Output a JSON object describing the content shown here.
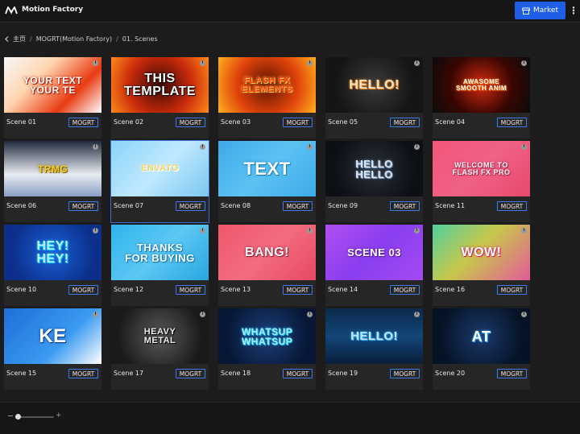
{
  "app": {
    "title": "Motion Factory"
  },
  "header": {
    "market_label": "Market"
  },
  "breadcrumb": [
    "主页",
    "MOGRT(Motion Factory)",
    "01. Scenes"
  ],
  "zoom": {
    "value": 0.08
  },
  "tiles": [
    {
      "label": "Scene 01",
      "badge": "MOGRT",
      "thumb": "YOUR TEXT\nYOUR TE",
      "bg": "linear-gradient(135deg,#f7f7f7 0%,#ffd6b0 35%,#e83b12 70%,#ffffff 100%)",
      "fg": "#ffffff",
      "shadow": "#b01a00",
      "size": 12
    },
    {
      "label": "Scene 02",
      "badge": "MOGRT",
      "thumb": "THIS\nTEMPLATE",
      "bg": "radial-gradient(circle at 50% 50%,#3a0a05 0%,#c92a0a 55%,#ff8a1a 100%)",
      "fg": "#ffffff",
      "shadow": "#000000",
      "size": 16
    },
    {
      "label": "Scene 03",
      "badge": "MOGRT",
      "thumb": "FLASH FX\nELEMENTS",
      "bg": "radial-gradient(circle at 50% 50%,#5a1200 0%,#e0430b 55%,#ffb01f 100%)",
      "fg": "#ff3a1a",
      "shadow": "#ffd24d",
      "size": 11
    },
    {
      "label": "Scene 05",
      "badge": "MOGRT",
      "thumb": "HELLO!",
      "bg": "radial-gradient(circle at 50% 50%,#3b3b3b 0%,#151515 70%)",
      "fg": "#f6e7c8",
      "shadow": "#ff8a1a",
      "size": 16
    },
    {
      "label": "Scene 04",
      "badge": "MOGRT",
      "thumb": "AWASOME\nSMOOTH ANIM",
      "bg": "radial-gradient(circle at 50% 50%,#d12a0f 0%,#3a0602 55%,#0b0b0b 100%)",
      "fg": "#ffffff",
      "shadow": "#ff6a00",
      "size": 8
    },
    {
      "label": "Scene 06",
      "badge": "MOGRT",
      "thumb": "TRMG",
      "bg": "linear-gradient(180deg,#20293c 0%,#e8ecf2 60%,#8aa0c4 100%)",
      "fg": "#f3d12a",
      "shadow": "#7a5a00",
      "size": 12
    },
    {
      "label": "Scene 07",
      "badge": "MOGRT",
      "thumb": "ENVATO",
      "bg": "linear-gradient(135deg,#8ad4f7 0%,#bfe8ff 50%,#7cc8ef 100%)",
      "fg": "#f4d35e",
      "shadow": "#ffffff",
      "size": 11
    },
    {
      "label": "Scene 08",
      "badge": "MOGRT",
      "thumb": "TEXT",
      "bg": "linear-gradient(135deg,#3ea9e8 0%,#5cc3f2 50%,#3ea9e8 100%)",
      "fg": "#ffffff",
      "shadow": "#1a7fc0",
      "size": 22
    },
    {
      "label": "Scene 09",
      "badge": "MOGRT",
      "thumb": "HELLO\nHELLO",
      "bg": "radial-gradient(circle at 50% 50%,#2a2f38 0%,#0c0f14 75%)",
      "fg": "#dfe6f0",
      "shadow": "#7aa0c8",
      "size": 13
    },
    {
      "label": "Scene 11",
      "badge": "MOGRT",
      "thumb": "WELCOME TO\nFLASH FX PRO",
      "bg": "linear-gradient(135deg,#f2557a 0%,#f06284 50%,#e8486e 100%)",
      "fg": "#ffffff",
      "shadow": "#b02346",
      "size": 9
    },
    {
      "label": "Scene 10",
      "badge": "MOGRT",
      "thumb": "HEY!\nHEY!",
      "bg": "radial-gradient(circle at 50% 50%,#1b5fd6 0%,#0b2f8a 75%)",
      "fg": "#bfefff",
      "shadow": "#00d0ff",
      "size": 16
    },
    {
      "label": "Scene 12",
      "badge": "MOGRT",
      "thumb": "THANKS\nFOR BUYING",
      "bg": "linear-gradient(135deg,#2fb4ec 0%,#5cc8f3 50%,#29a6e0 100%)",
      "fg": "#ffffff",
      "shadow": "#1476b0",
      "size": 13
    },
    {
      "label": "Scene 13",
      "badge": "MOGRT",
      "thumb": "BANG!",
      "bg": "linear-gradient(135deg,#f0576e 0%,#f36c80 50%,#e84862 100%)",
      "fg": "#ffffff",
      "shadow": "#9a1a30",
      "size": 16
    },
    {
      "label": "Scene 14",
      "badge": "MOGRT",
      "thumb": "SCENE 03",
      "bg": "linear-gradient(135deg,#b04ef0 0%,#8a3ef0 50%,#a24cf2 100%)",
      "fg": "#ffffff",
      "shadow": "#5a1ea0",
      "size": 13
    },
    {
      "label": "Scene 16",
      "badge": "MOGRT",
      "thumb": "WOW!",
      "bg": "linear-gradient(135deg,#4fd0a0 0%,#c8c84a 45%,#e35a9a 100%)",
      "fg": "#ffffff",
      "shadow": "#d8204a",
      "size": 16
    },
    {
      "label": "Scene 15",
      "badge": "MOGRT",
      "thumb": "KE",
      "bg": "linear-gradient(135deg,#1f6fd8 0%,#3a9af0 60%,#ffffff 100%)",
      "fg": "#ffffff",
      "shadow": "#0a3a90",
      "size": 24
    },
    {
      "label": "Scene 17",
      "badge": "MOGRT",
      "thumb": "HEAVY\nMETAL",
      "bg": "radial-gradient(circle at 50% 50%,#5a5a5a 0%,#1a1a1a 75%)",
      "fg": "#f0f0f0",
      "shadow": "#000000",
      "size": 11
    },
    {
      "label": "Scene 18",
      "badge": "MOGRT",
      "thumb": "WHATSUP\nWHATSUP",
      "bg": "radial-gradient(circle at 50% 50%,#1d3f7a 0%,#071735 75%)",
      "fg": "#a9ecff",
      "shadow": "#18c8ff",
      "size": 12
    },
    {
      "label": "Scene 19",
      "badge": "MOGRT",
      "thumb": "HELLO!",
      "bg": "linear-gradient(180deg,#0c2a4c 0%,#124578 50%,#0a1e3a 100%)",
      "fg": "#bfe6ff",
      "shadow": "#38b0ff",
      "size": 15
    },
    {
      "label": "Scene 20",
      "badge": "MOGRT",
      "thumb": "AT",
      "bg": "radial-gradient(circle at 50% 50%,#1a3a6a 0%,#061226 75%)",
      "fg": "#ffffff",
      "shadow": "#30a8ff",
      "size": 18
    }
  ],
  "selected_tile": "Scene 07"
}
